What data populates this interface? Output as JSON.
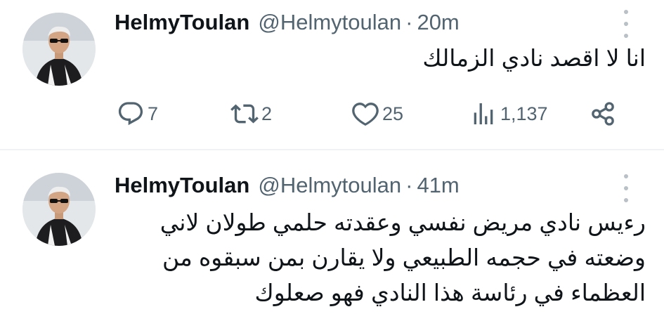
{
  "tweets": [
    {
      "name": "HelmyToulan",
      "handle": "@Helmytoulan",
      "separator": "·",
      "time": "20m",
      "text_lines": [
        "انا لا اقصد نادي الزمالك"
      ],
      "stats": {
        "replies": "7",
        "retweets": "2",
        "likes": "25",
        "views": "1,137"
      }
    },
    {
      "name": "HelmyToulan",
      "handle": "@Helmytoulan",
      "separator": "·",
      "time": "41m",
      "text_lines": [
        "رءيس نادي مريض نفسي وعقدته حلمي طولان لاني",
        "وضعته في حجمه الطبيعي ولا يقارن بمن سبقوه من",
        "العظماء في رئاسة هذا النادي فهو صعلوك"
      ]
    }
  ],
  "icons": {
    "reply": "reply-icon",
    "retweet": "retweet-icon",
    "like": "heart-icon",
    "views": "views-chart-icon",
    "share": "share-icon",
    "more": "more-dots-icon"
  },
  "colors": {
    "text_primary": "#0f1419",
    "text_secondary": "#536471",
    "divider": "#eff3f4"
  }
}
